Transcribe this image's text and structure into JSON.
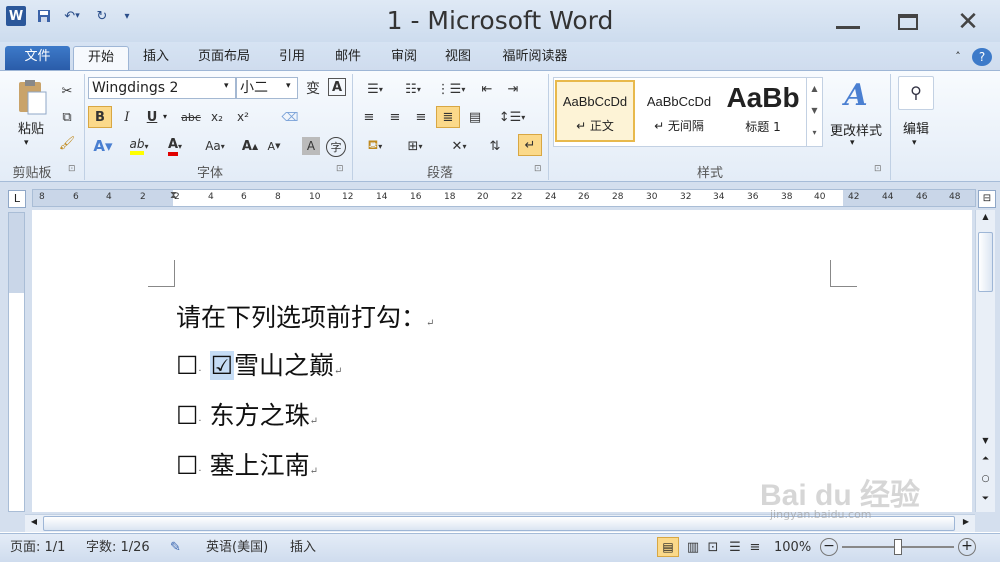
{
  "window": {
    "title": "1 - Microsoft Word"
  },
  "quick_access": {
    "word_icon": "W",
    "more": "▾"
  },
  "tabs": [
    {
      "label": "文件"
    },
    {
      "label": "开始"
    },
    {
      "label": "插入"
    },
    {
      "label": "页面布局"
    },
    {
      "label": "引用"
    },
    {
      "label": "邮件"
    },
    {
      "label": "审阅"
    },
    {
      "label": "视图"
    },
    {
      "label": "福昕阅读器"
    }
  ],
  "clipboard": {
    "paste_label": "粘贴",
    "group": "剪贴板"
  },
  "font": {
    "name": "Wingdings 2",
    "size": "小二",
    "group": "字体",
    "phonetic": "变",
    "border_char": "A",
    "bold": "B",
    "italic": "I",
    "underline": "U",
    "strike": "abc",
    "sub": "x₂",
    "sup": "x²",
    "case": "Aa",
    "grow": "A",
    "shrink": "A",
    "shade": "A",
    "enclose": "字"
  },
  "paragraph": {
    "group": "段落"
  },
  "styles": {
    "group": "样式",
    "items": [
      {
        "preview": "AaBbCcDd",
        "name": "↵ 正文"
      },
      {
        "preview": "AaBbCcDd",
        "name": "↵ 无间隔"
      },
      {
        "preview": "AaBb",
        "name": "标题 1"
      }
    ],
    "change_label": "更改样式",
    "change_icon_text": "A"
  },
  "editing": {
    "label": "编辑"
  },
  "ruler": {
    "h_ticks": [
      "8",
      "6",
      "4",
      "2",
      "2",
      "4",
      "6",
      "8",
      "10",
      "12",
      "14",
      "16",
      "18",
      "20",
      "22",
      "24",
      "26",
      "28",
      "30",
      "32",
      "34",
      "36",
      "38",
      "40",
      "42",
      "44",
      "46",
      "48"
    ]
  },
  "document": {
    "prompt": "请在下列选项前打勾：",
    "options": [
      {
        "box": "☐",
        "check": "☑",
        "text": "雪山之巅"
      },
      {
        "box": "☐",
        "text": "东方之珠"
      },
      {
        "box": "☐",
        "text": "塞上江南"
      }
    ],
    "para_mark": "↵"
  },
  "status": {
    "page": "页面: 1/1",
    "words": "字数: 1/26",
    "language": "英语(美国)",
    "mode": "插入",
    "zoom": "100%"
  },
  "watermark": {
    "text": "Bai du 经验",
    "url": "jingyan.baidu.com"
  }
}
